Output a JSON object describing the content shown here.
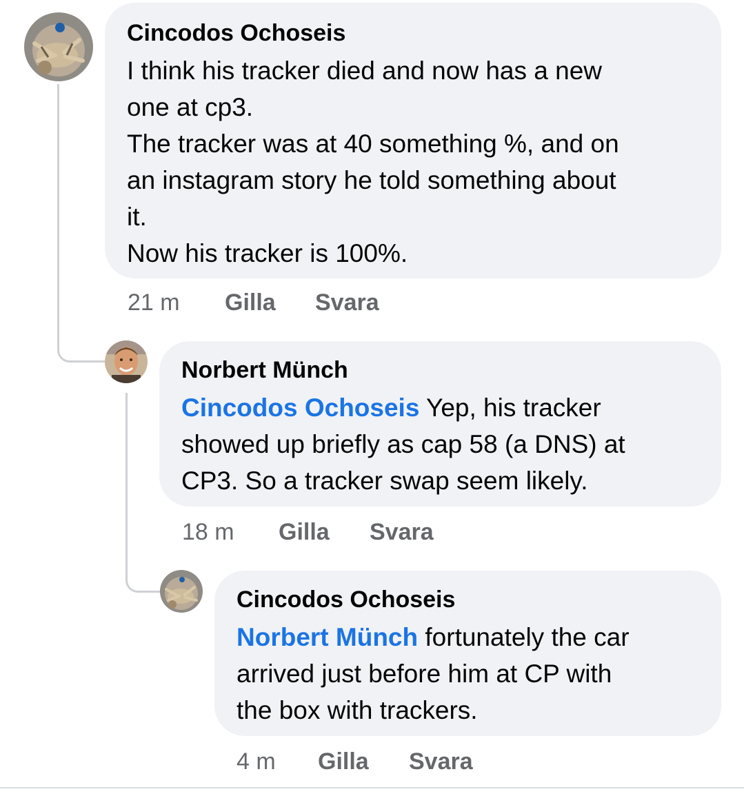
{
  "comments": [
    {
      "author": "Cincodos Ochoseis",
      "avatar_icon": "crab-photo-avatar",
      "lines": [
        "I think his tracker died and now has a new",
        "one at cp3.",
        "The tracker was at 40 something %, and on",
        "an instagram story he told something about",
        "it.",
        "Now his tracker is 100%."
      ],
      "time": "21 m",
      "like_label": "Gilla",
      "reply_label": "Svara"
    },
    {
      "author": "Norbert Münch",
      "avatar_icon": "man-photo-avatar",
      "mention": "Cincodos Ochoseis",
      "first_line_rest": " Yep, his tracker",
      "lines": [
        "showed up briefly as cap 58 (a DNS) at",
        "CP3. So a tracker swap seem likely."
      ],
      "time": "18 m",
      "like_label": "Gilla",
      "reply_label": "Svara"
    },
    {
      "author": "Cincodos Ochoseis",
      "avatar_icon": "crab-photo-avatar",
      "mention": "Norbert Münch",
      "first_line_rest": " fortunately the car",
      "lines": [
        "arrived just before him at CP with",
        "the box with trackers."
      ],
      "time": "4 m",
      "like_label": "Gilla",
      "reply_label": "Svara"
    }
  ],
  "colors": {
    "bubble": "#f0f2f5",
    "mention": "#1b74e4",
    "meta": "#65676b"
  }
}
